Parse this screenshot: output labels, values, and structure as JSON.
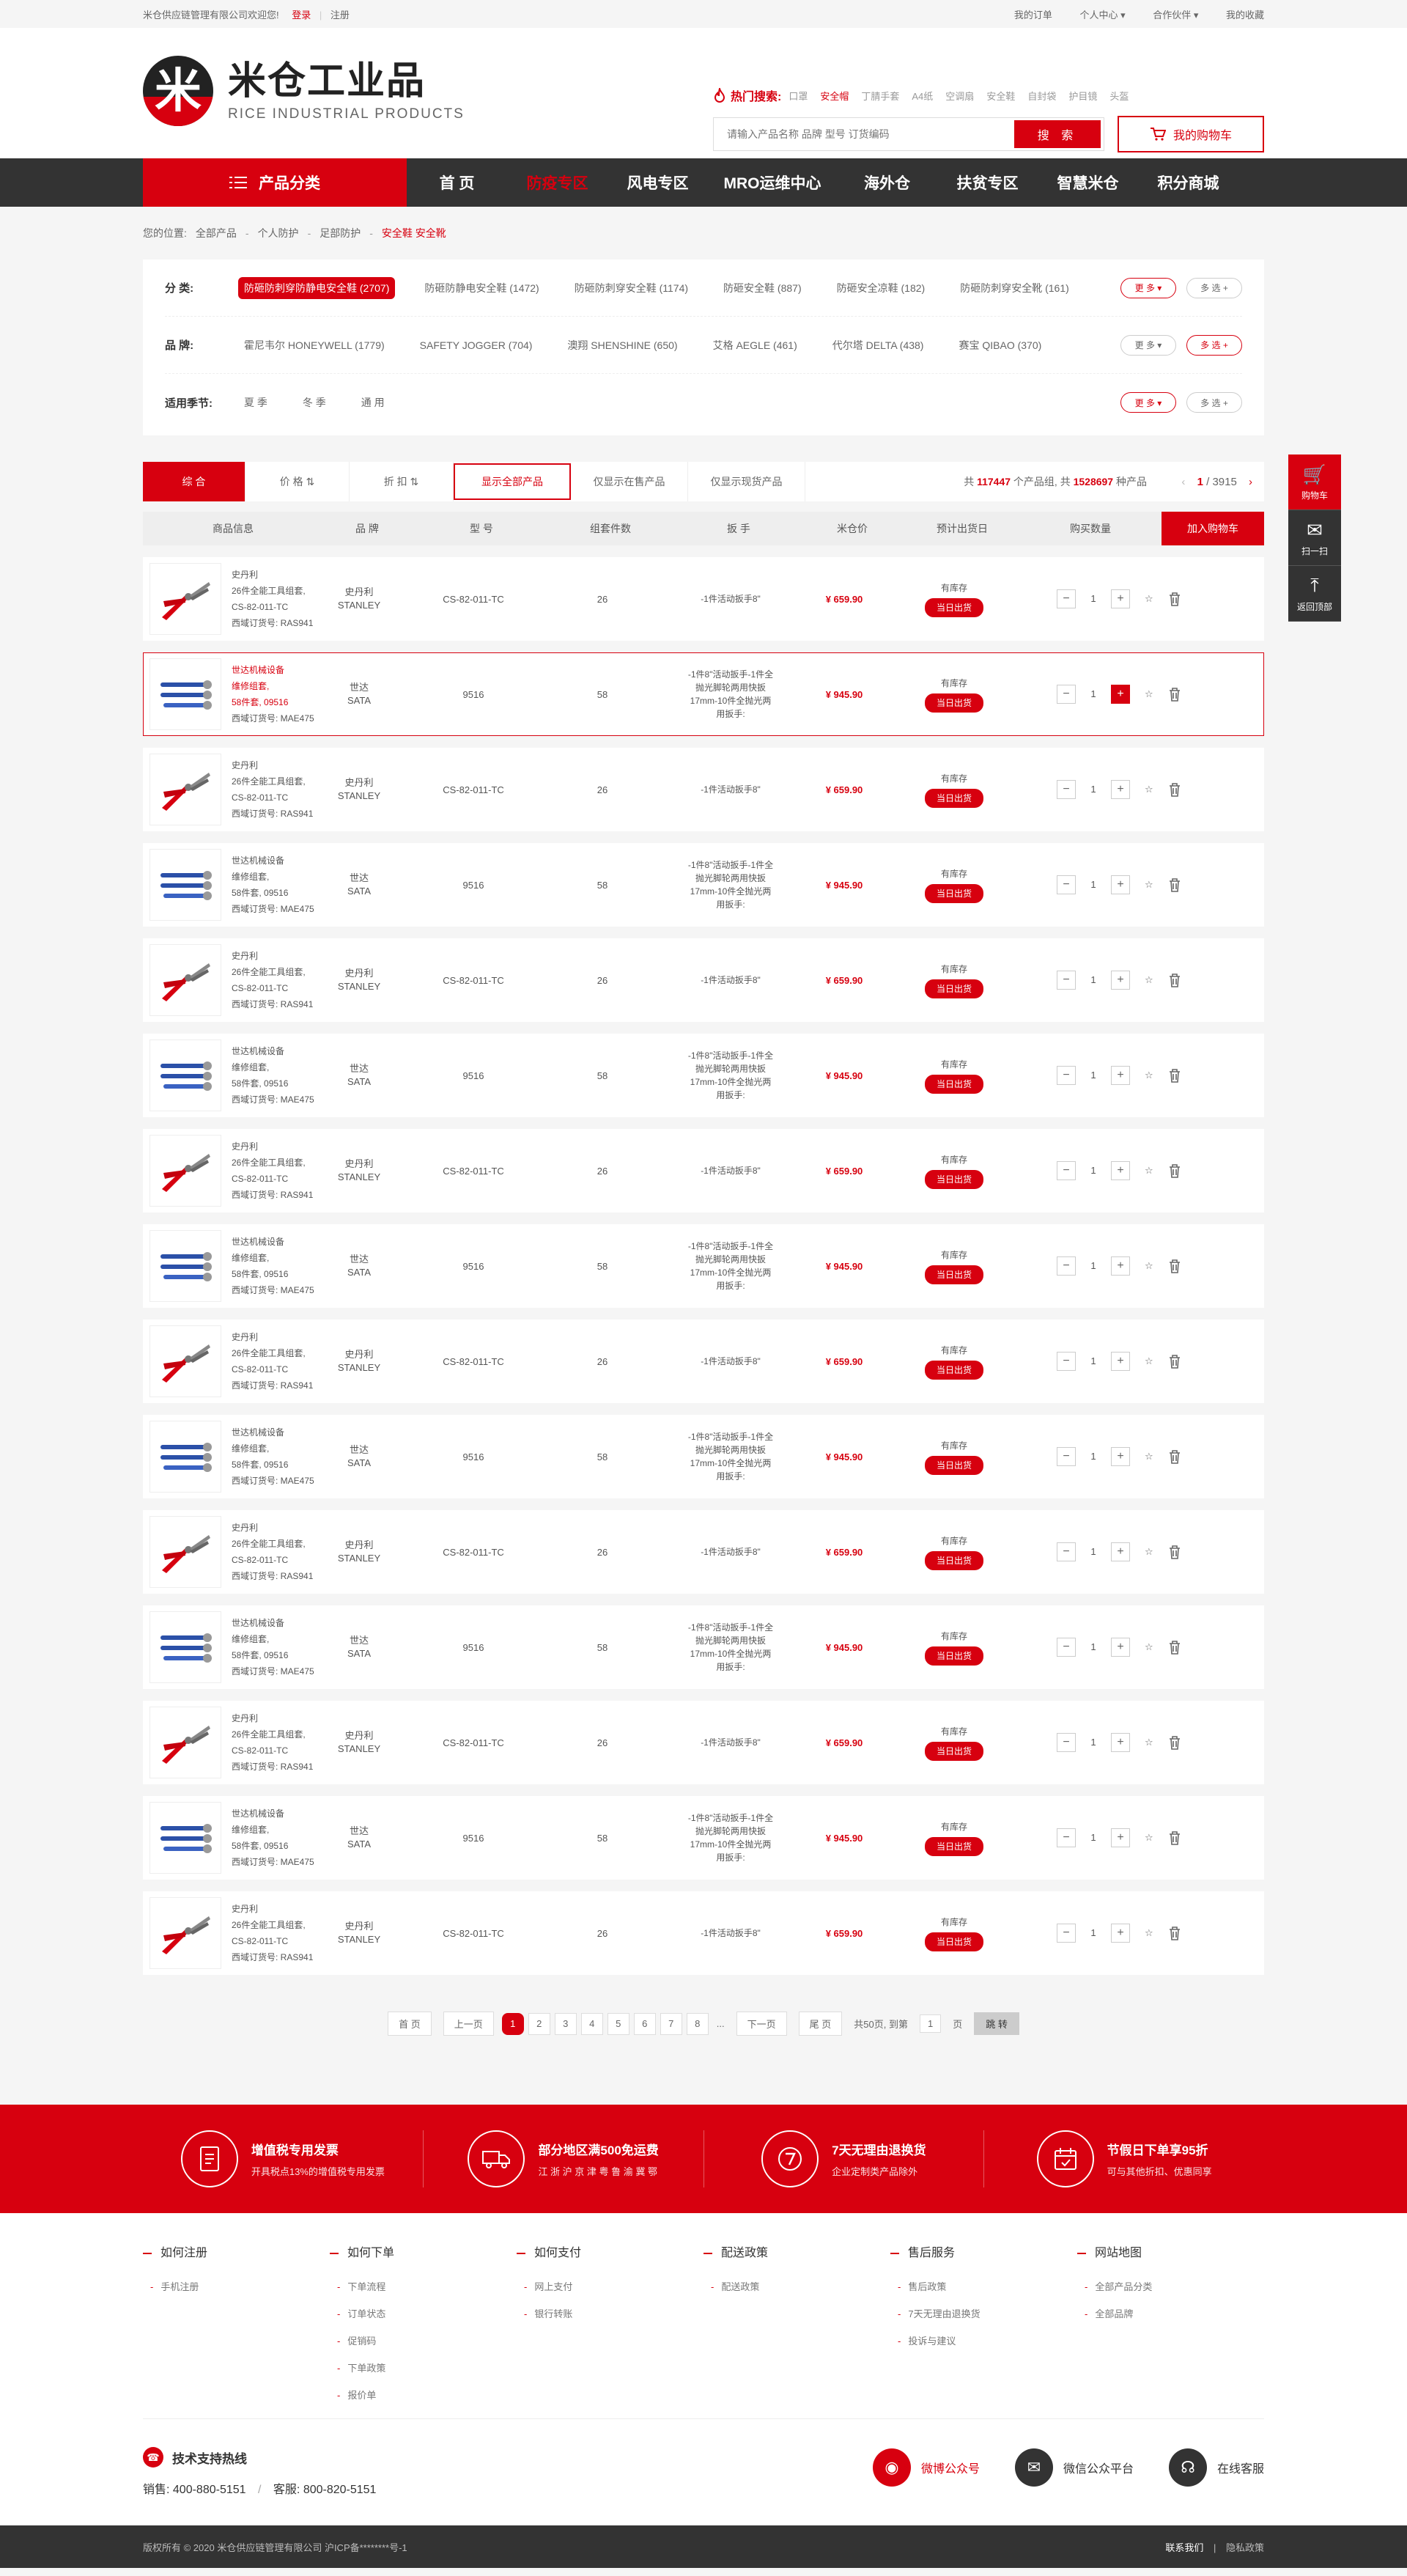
{
  "topbar": {
    "welcome": "米仓供应链管理有限公司欢迎您!",
    "login": "登录",
    "register": "注册",
    "links": [
      "我的订单",
      "个人中心 ▾",
      "合作伙伴 ▾",
      "我的收藏"
    ]
  },
  "header": {
    "logo_mark": "米",
    "logo_cn": "米仓工业品",
    "logo_en": "RICE INDUSTRIAL PRODUCTS",
    "hot_label": "热门搜索:",
    "hot_keywords": [
      "口罩",
      "安全帽",
      "丁腈手套",
      "A4纸",
      "空调扇",
      "安全鞋",
      "自封袋",
      "护目镜",
      "头盔"
    ],
    "search_placeholder": "请输入产品名称 品牌 型号 订货编码",
    "search_button": "搜 索",
    "cart": "我的购物车"
  },
  "nav": {
    "category": "产品分类",
    "items": [
      "首 页",
      "防疫专区",
      "风电专区",
      "MRO运维中心",
      "海外仓",
      "扶贫专区",
      "智慧米仓",
      "积分商城"
    ]
  },
  "breadcrumb": {
    "label": "您的位置:",
    "items": [
      "全部产品",
      "个人防护",
      "足部防护"
    ],
    "current": "安全鞋 安全靴"
  },
  "filters": {
    "category_label": "分 类:",
    "categories": [
      "防砸防刺穿防静电安全鞋 (2707)",
      "防砸防静电安全鞋 (1472)",
      "防砸防刺穿安全鞋 (1174)",
      "防砸安全鞋 (887)",
      "防砸安全凉鞋 (182)",
      "防砸防刺穿安全靴 (161)"
    ],
    "brand_label": "品 牌:",
    "brands": [
      "霍尼韦尔 HONEYWELL (1779)",
      "SAFETY JOGGER (704)",
      "澳翔 SHENSHINE (650)",
      "艾格 AEGLE (461)",
      "代尔塔 DELTA (438)",
      "赛宝 QIBAO (370)"
    ],
    "season_label": "适用季节:",
    "seasons": [
      "夏 季",
      "冬 季",
      "通 用"
    ],
    "more": "更 多 ▾",
    "multi": "多 选 +"
  },
  "sortbar": {
    "items": [
      "综 合",
      "价 格 ⇅",
      "折 扣 ⇅",
      "显示全部产品",
      "仅显示在售产品",
      "仅显示现货产品"
    ],
    "count_prefix": "共",
    "count_products": "117447",
    "count_mid": "个产品组, 共",
    "count_items": "1528697",
    "count_suffix": "种产品",
    "page_current": "1",
    "page_total": "/ 3915"
  },
  "table": {
    "headers": [
      "商品信息",
      "品 牌",
      "型 号",
      "组套件数",
      "扳 手",
      "米仓价",
      "预计出货日",
      "购买数量"
    ],
    "add_cart": "加入购物车"
  },
  "products": [
    {
      "lines": [
        "史丹利",
        "26件全能工具组套,",
        "CS-82-011-TC",
        "西域订货号: RAS941"
      ],
      "brand": [
        "史丹利",
        "STANLEY"
      ],
      "model": "CS-82-011-TC",
      "count": "26",
      "spec": [
        "-1件活动扳手8\""
      ],
      "price": "¥ 659.90",
      "stock": "有库存",
      "ship": "当日出货",
      "qty": "1",
      "type": "pliers"
    },
    {
      "lines": [
        "世达机械设备",
        "维修组套,",
        "58件套, 09516",
        "西域订货号: MAE475"
      ],
      "brand": [
        "世达",
        "SATA"
      ],
      "model": "9516",
      "count": "58",
      "spec": [
        "-1件8\"活动扳手-1件全",
        "抛光脚轮两用快扳",
        "17mm-10件全抛光两",
        "用扳手:"
      ],
      "price": "¥ 945.90",
      "stock": "有库存",
      "ship": "当日出货",
      "qty": "1",
      "type": "wrench",
      "hl": true
    },
    {
      "lines": [
        "史丹利",
        "26件全能工具组套,",
        "CS-82-011-TC",
        "西域订货号: RAS941"
      ],
      "brand": [
        "史丹利",
        "STANLEY"
      ],
      "model": "CS-82-011-TC",
      "count": "26",
      "spec": [
        "-1件活动扳手8\""
      ],
      "price": "¥ 659.90",
      "stock": "有库存",
      "ship": "当日出货",
      "qty": "1",
      "type": "pliers"
    },
    {
      "lines": [
        "世达机械设备",
        "维修组套,",
        "58件套, 09516",
        "西域订货号: MAE475"
      ],
      "brand": [
        "世达",
        "SATA"
      ],
      "model": "9516",
      "count": "58",
      "spec": [
        "-1件8\"活动扳手-1件全",
        "抛光脚轮两用快扳",
        "17mm-10件全抛光两",
        "用扳手:"
      ],
      "price": "¥ 945.90",
      "stock": "有库存",
      "ship": "当日出货",
      "qty": "1",
      "type": "wrench"
    },
    {
      "lines": [
        "史丹利",
        "26件全能工具组套,",
        "CS-82-011-TC",
        "西域订货号: RAS941"
      ],
      "brand": [
        "史丹利",
        "STANLEY"
      ],
      "model": "CS-82-011-TC",
      "count": "26",
      "spec": [
        "-1件活动扳手8\""
      ],
      "price": "¥ 659.90",
      "stock": "有库存",
      "ship": "当日出货",
      "qty": "1",
      "type": "pliers"
    },
    {
      "lines": [
        "世达机械设备",
        "维修组套,",
        "58件套, 09516",
        "西域订货号: MAE475"
      ],
      "brand": [
        "世达",
        "SATA"
      ],
      "model": "9516",
      "count": "58",
      "spec": [
        "-1件8\"活动扳手-1件全",
        "抛光脚轮两用快扳",
        "17mm-10件全抛光两",
        "用扳手:"
      ],
      "price": "¥ 945.90",
      "stock": "有库存",
      "ship": "当日出货",
      "qty": "1",
      "type": "wrench"
    },
    {
      "lines": [
        "史丹利",
        "26件全能工具组套,",
        "CS-82-011-TC",
        "西域订货号: RAS941"
      ],
      "brand": [
        "史丹利",
        "STANLEY"
      ],
      "model": "CS-82-011-TC",
      "count": "26",
      "spec": [
        "-1件活动扳手8\""
      ],
      "price": "¥ 659.90",
      "stock": "有库存",
      "ship": "当日出货",
      "qty": "1",
      "type": "pliers"
    },
    {
      "lines": [
        "世达机械设备",
        "维修组套,",
        "58件套, 09516",
        "西域订货号: MAE475"
      ],
      "brand": [
        "世达",
        "SATA"
      ],
      "model": "9516",
      "count": "58",
      "spec": [
        "-1件8\"活动扳手-1件全",
        "抛光脚轮两用快扳",
        "17mm-10件全抛光两",
        "用扳手:"
      ],
      "price": "¥ 945.90",
      "stock": "有库存",
      "ship": "当日出货",
      "qty": "1",
      "type": "wrench"
    },
    {
      "lines": [
        "史丹利",
        "26件全能工具组套,",
        "CS-82-011-TC",
        "西域订货号: RAS941"
      ],
      "brand": [
        "史丹利",
        "STANLEY"
      ],
      "model": "CS-82-011-TC",
      "count": "26",
      "spec": [
        "-1件活动扳手8\""
      ],
      "price": "¥ 659.90",
      "stock": "有库存",
      "ship": "当日出货",
      "qty": "1",
      "type": "pliers"
    },
    {
      "lines": [
        "世达机械设备",
        "维修组套,",
        "58件套, 09516",
        "西域订货号: MAE475"
      ],
      "brand": [
        "世达",
        "SATA"
      ],
      "model": "9516",
      "count": "58",
      "spec": [
        "-1件8\"活动扳手-1件全",
        "抛光脚轮两用快扳",
        "17mm-10件全抛光两",
        "用扳手:"
      ],
      "price": "¥ 945.90",
      "stock": "有库存",
      "ship": "当日出货",
      "qty": "1",
      "type": "wrench"
    },
    {
      "lines": [
        "史丹利",
        "26件全能工具组套,",
        "CS-82-011-TC",
        "西域订货号: RAS941"
      ],
      "brand": [
        "史丹利",
        "STANLEY"
      ],
      "model": "CS-82-011-TC",
      "count": "26",
      "spec": [
        "-1件活动扳手8\""
      ],
      "price": "¥ 659.90",
      "stock": "有库存",
      "ship": "当日出货",
      "qty": "1",
      "type": "pliers"
    },
    {
      "lines": [
        "世达机械设备",
        "维修组套,",
        "58件套, 09516",
        "西域订货号: MAE475"
      ],
      "brand": [
        "世达",
        "SATA"
      ],
      "model": "9516",
      "count": "58",
      "spec": [
        "-1件8\"活动扳手-1件全",
        "抛光脚轮两用快扳",
        "17mm-10件全抛光两",
        "用扳手:"
      ],
      "price": "¥ 945.90",
      "stock": "有库存",
      "ship": "当日出货",
      "qty": "1",
      "type": "wrench"
    },
    {
      "lines": [
        "史丹利",
        "26件全能工具组套,",
        "CS-82-011-TC",
        "西域订货号: RAS941"
      ],
      "brand": [
        "史丹利",
        "STANLEY"
      ],
      "model": "CS-82-011-TC",
      "count": "26",
      "spec": [
        "-1件活动扳手8\""
      ],
      "price": "¥ 659.90",
      "stock": "有库存",
      "ship": "当日出货",
      "qty": "1",
      "type": "pliers"
    },
    {
      "lines": [
        "世达机械设备",
        "维修组套,",
        "58件套, 09516",
        "西域订货号: MAE475"
      ],
      "brand": [
        "世达",
        "SATA"
      ],
      "model": "9516",
      "count": "58",
      "spec": [
        "-1件8\"活动扳手-1件全",
        "抛光脚轮两用快扳",
        "17mm-10件全抛光两",
        "用扳手:"
      ],
      "price": "¥ 945.90",
      "stock": "有库存",
      "ship": "当日出货",
      "qty": "1",
      "type": "wrench"
    },
    {
      "lines": [
        "史丹利",
        "26件全能工具组套,",
        "CS-82-011-TC",
        "西域订货号: RAS941"
      ],
      "brand": [
        "史丹利",
        "STANLEY"
      ],
      "model": "CS-82-011-TC",
      "count": "26",
      "spec": [
        "-1件活动扳手8\""
      ],
      "price": "¥ 659.90",
      "stock": "有库存",
      "ship": "当日出货",
      "qty": "1",
      "type": "pliers"
    }
  ],
  "pager": {
    "first": "首 页",
    "prev": "上一页",
    "pages": [
      "1",
      "2",
      "3",
      "4",
      "5",
      "6",
      "7",
      "8",
      "..."
    ],
    "next": "下一页",
    "last": "尾 页",
    "total": "共50页, 到第",
    "input": "1",
    "unit": "页",
    "go": "跳 转"
  },
  "services": [
    {
      "title": "增值税专用发票",
      "sub": "开具税点13%的增值税专用发票",
      "icon": "invoice-icon"
    },
    {
      "title": "部分地区满500免运费",
      "sub": "江 浙 沪 京 津 粤 鲁 渝 冀 鄂",
      "icon": "truck-icon"
    },
    {
      "title": "7天无理由退换货",
      "sub": "企业定制类产品除外",
      "icon": "seven-day-icon"
    },
    {
      "title": "节假日下单享95折",
      "sub": "可与其他折扣、优惠同享",
      "icon": "calendar-icon"
    }
  ],
  "footer_columns": [
    {
      "title": "如何注册",
      "items": [
        "手机注册"
      ]
    },
    {
      "title": "如何下单",
      "items": [
        "下单流程",
        "订单状态",
        "促销码",
        "下单政策",
        "报价单"
      ]
    },
    {
      "title": "如何支付",
      "items": [
        "网上支付",
        "银行转账"
      ]
    },
    {
      "title": "配送政策",
      "items": [
        "配送政策"
      ]
    },
    {
      "title": "售后服务",
      "items": [
        "售后政策",
        "7天无理由退换货",
        "投诉与建议"
      ]
    },
    {
      "title": "网站地图",
      "items": [
        "全部产品分类",
        "全部品牌"
      ]
    }
  ],
  "support": {
    "title": "技术支持热线",
    "sales_label": "销售:",
    "sales": "400-880-5151",
    "service_label": "客服:",
    "service": "800-820-5151",
    "social": [
      "微博公众号",
      "微信公众平台",
      "在线客服"
    ]
  },
  "copyright": {
    "text": "版权所有 © 2020 米仓供应链管理有限公司 沪ICP备********号-1",
    "links": [
      "联系我们",
      "隐私政策"
    ]
  },
  "float": [
    "购物车",
    "扫一扫",
    "返回顶部"
  ],
  "colors": {
    "accent": "#d7000f",
    "nav": "#333333"
  }
}
